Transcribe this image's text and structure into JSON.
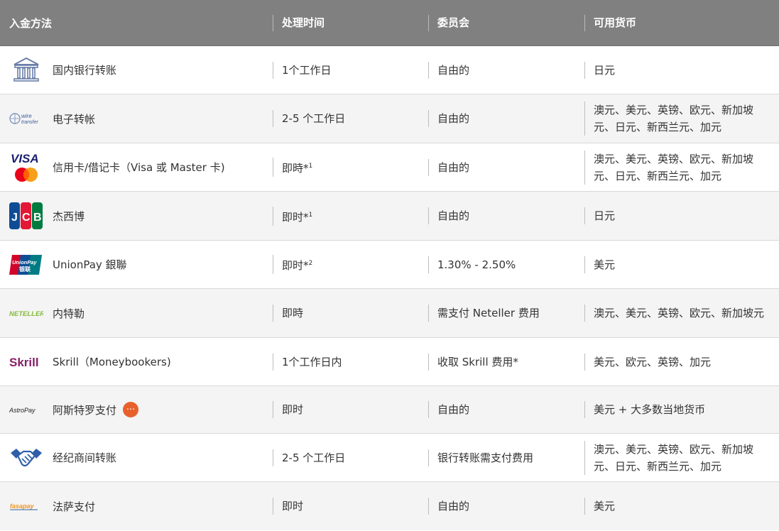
{
  "header": {
    "method": "入金方法",
    "processing_time": "处理时间",
    "commission": "委员会",
    "currencies": "可用货币"
  },
  "rows": [
    {
      "name": "国内银行转账",
      "time": "1个工作日",
      "time_sup": "",
      "commission": "自由的",
      "currencies": "日元",
      "icon": "bank-icon"
    },
    {
      "name": "电子转帐",
      "time": "2-5 个工作日",
      "time_sup": "",
      "commission": "自由的",
      "currencies": "澳元、美元、英镑、欧元、新加坡元、日元、新西兰元、加元",
      "icon": "wire-transfer-logo",
      "logo_text1": "wire",
      "logo_text2": "transfer"
    },
    {
      "name": "信用卡/借记卡（Visa 或 Master 卡)",
      "time": "即時*",
      "time_sup": "1",
      "commission": "自由的",
      "currencies": "澳元、美元、英镑、欧元、新加坡元、日元、新西兰元、加元",
      "icon": "visa-mastercard-logo",
      "logo_text1": "VISA"
    },
    {
      "name": "杰西博",
      "time": "即时*",
      "time_sup": "1",
      "commission": "自由的",
      "currencies": "日元",
      "icon": "jcb-logo",
      "logo_text1": "J",
      "logo_text2": "C",
      "logo_text3": "B"
    },
    {
      "name": "UnionPay 銀聯",
      "time": "即时*",
      "time_sup": "2",
      "commission": "1.30% - 2.50%",
      "currencies": "美元",
      "icon": "unionpay-logo",
      "logo_text1": "UnionPay",
      "logo_text2": "银联"
    },
    {
      "name": "内特勒",
      "time": "即時",
      "time_sup": "",
      "commission": "需支付 Neteller 费用",
      "currencies": "澳元、美元、英镑、欧元、新加坡元",
      "icon": "neteller-logo",
      "logo_text1": "NETELLER"
    },
    {
      "name": "Skrill（Moneybookers)",
      "time": "1个工作日内",
      "time_sup": "",
      "commission": "收取 Skrill 费用*",
      "currencies": "美元、欧元、英镑、加元",
      "icon": "skrill-logo",
      "logo_text1": "Skrill"
    },
    {
      "name": "阿斯特罗支付",
      "time": "即时",
      "time_sup": "",
      "commission": "自由的",
      "currencies": "美元 + 大多数当地货币",
      "icon": "astropay-logo",
      "logo_text1": "AstroPay",
      "has_more": true,
      "more_text": "···"
    },
    {
      "name": "经纪商间转账",
      "time": "2-5 个工作日",
      "time_sup": "",
      "commission": "银行转账需支付费用",
      "currencies": "澳元、美元、英镑、欧元、新加坡元、日元、新西兰元、加元",
      "icon": "handshake-icon"
    },
    {
      "name": "法萨支付",
      "time": "即时",
      "time_sup": "",
      "commission": "自由的",
      "currencies": "美元",
      "icon": "fasapay-logo",
      "logo_text1": "fasapay"
    }
  ],
  "colors": {
    "header_bg": "#808080",
    "alt_row_bg": "#f4f4f4",
    "accent_orange": "#e8612c",
    "skrill_purple": "#862165",
    "neteller_green": "#83ba3b",
    "visa_blue": "#1a1f71"
  }
}
